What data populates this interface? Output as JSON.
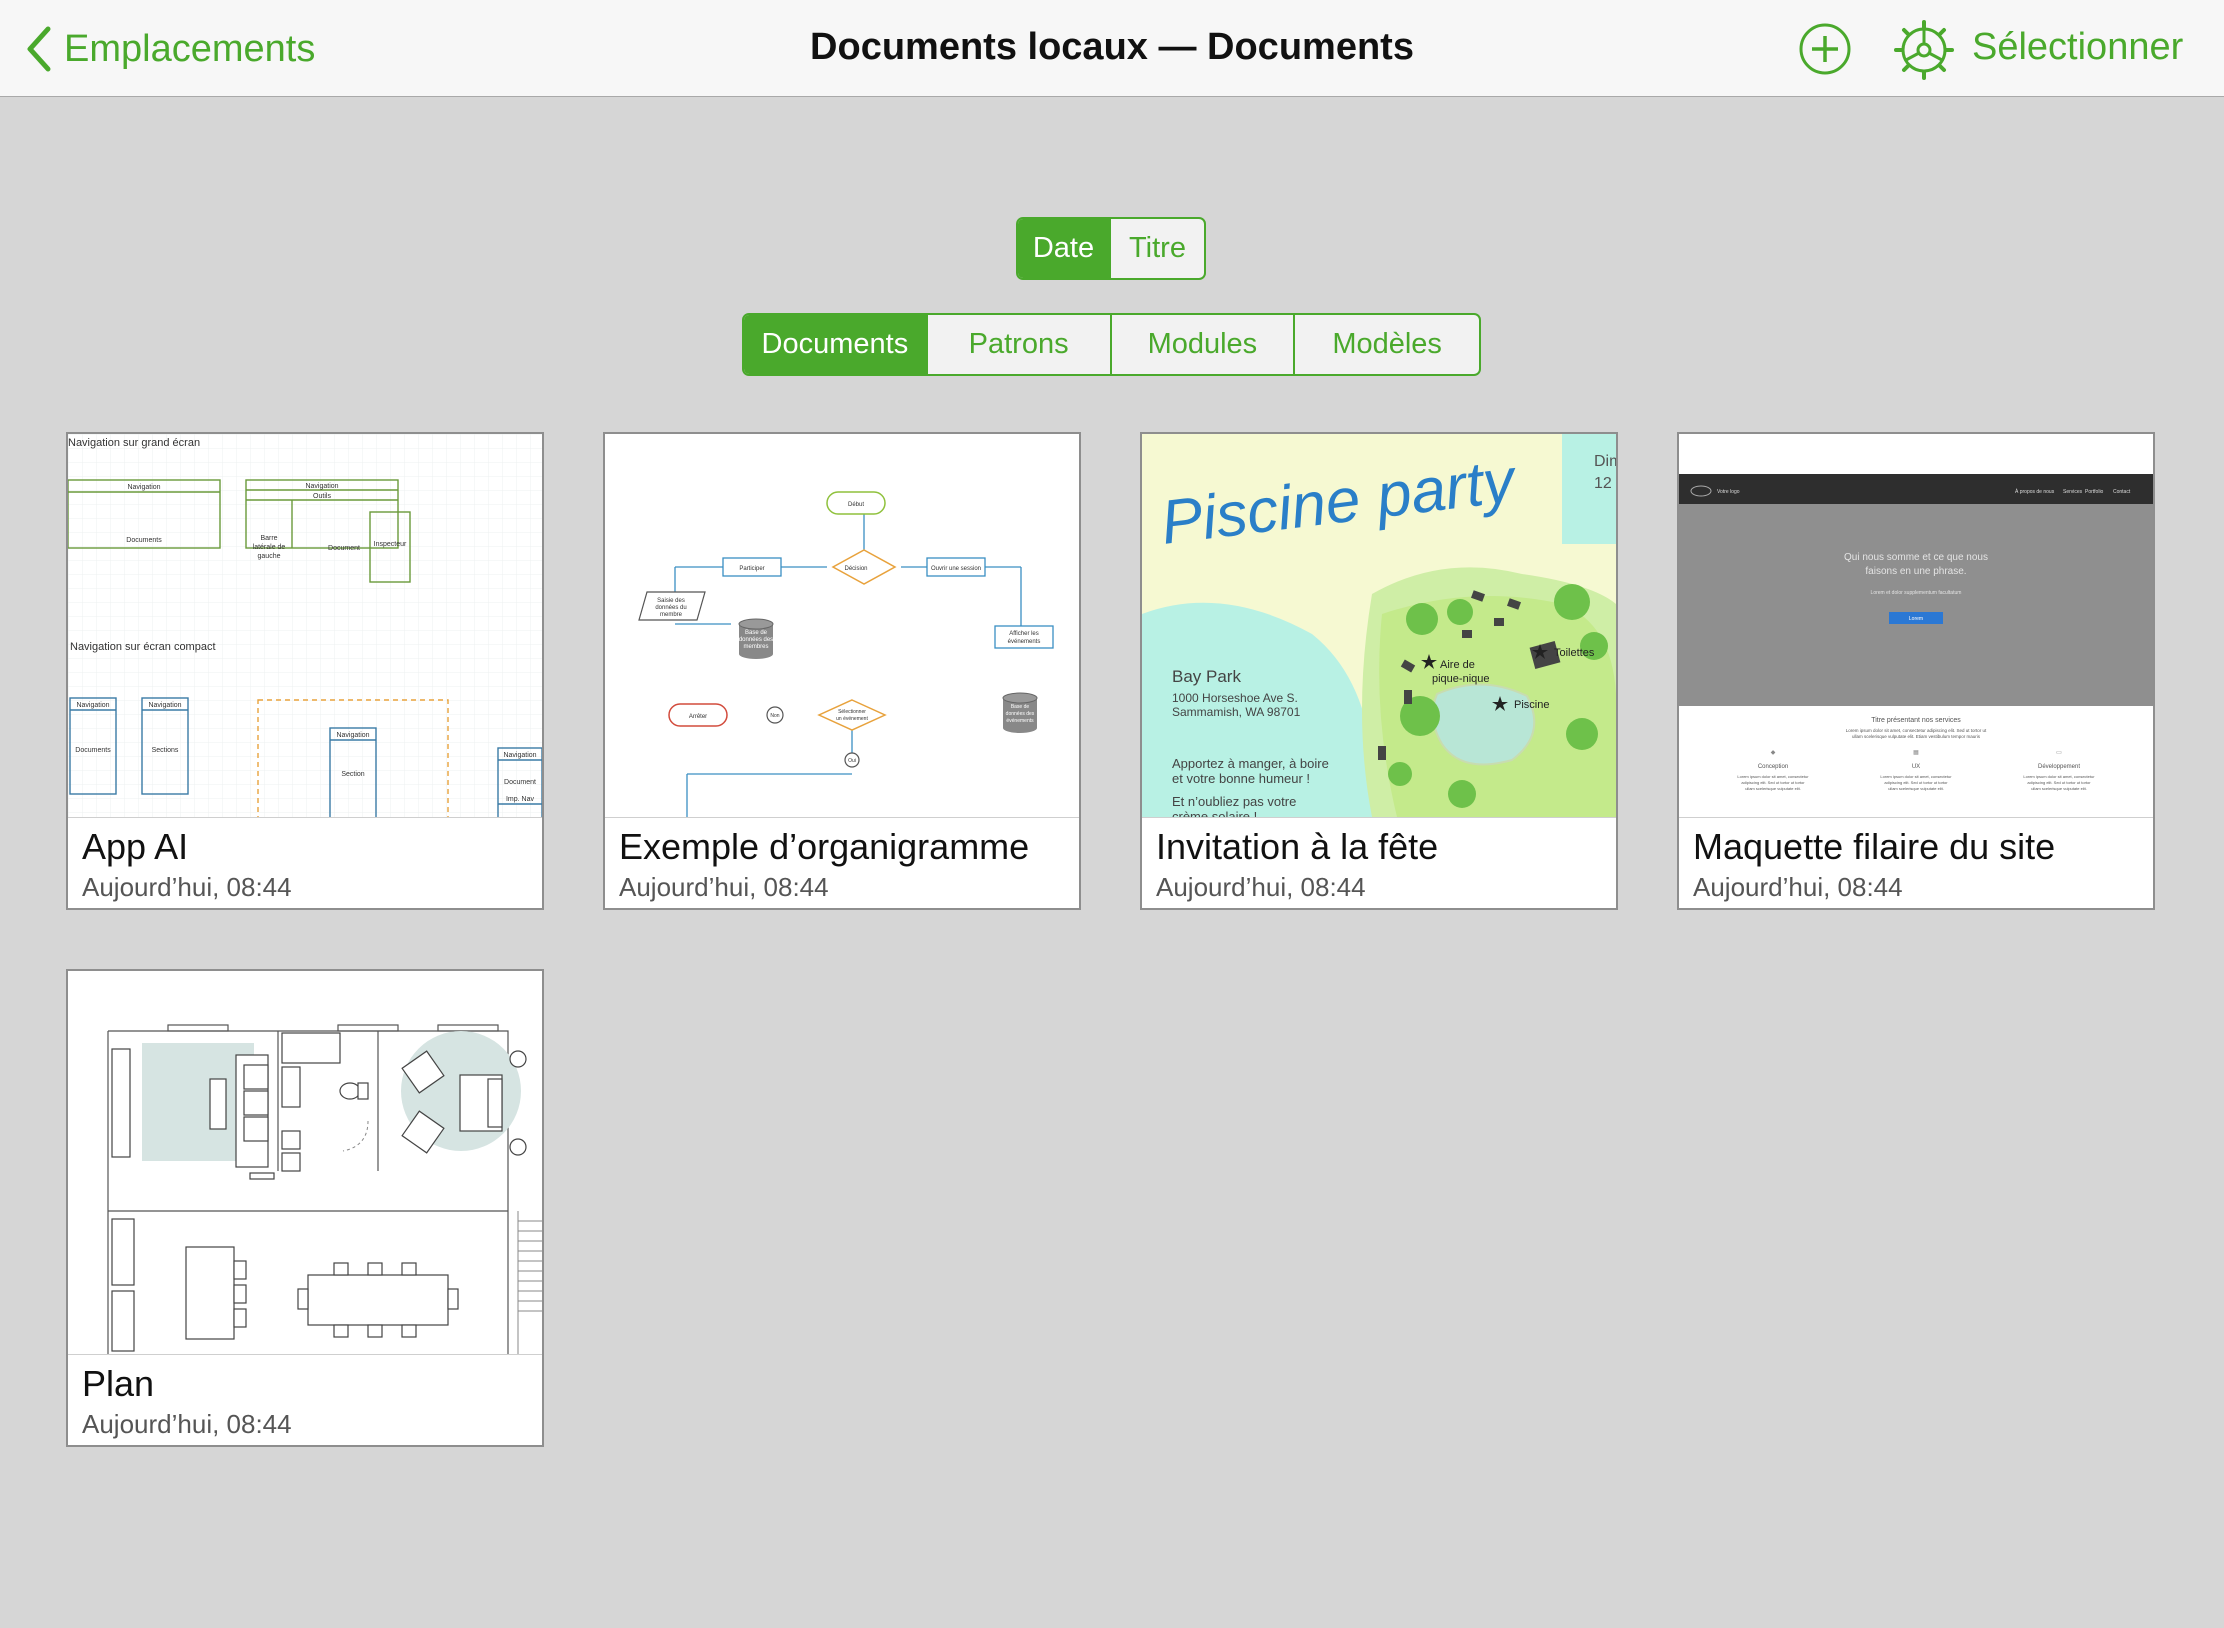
{
  "navbar": {
    "back_label": "Emplacements",
    "title": "Documents locaux — Documents",
    "add_icon": "plus-circle-icon",
    "settings_icon": "gear-icon",
    "select_label": "Sélectionner"
  },
  "sort_control": {
    "options": [
      "Date",
      "Titre"
    ],
    "selected": "Date"
  },
  "type_control": {
    "options": [
      "Documents",
      "Patrons",
      "Modules",
      "Modèles"
    ],
    "selected": "Documents"
  },
  "documents": [
    {
      "title": "App AI",
      "date": "Aujourd’hui, 08:44",
      "thumb": {
        "heading_large": "Navigation sur grand écran",
        "heading_compact": "Navigation sur écran compact",
        "nav": "Navigation",
        "outils": "Outils",
        "documents": "Documents",
        "barre": [
          "Barre",
          "latérale de",
          "gauche"
        ],
        "document": "Document",
        "inspecteur": "Inspecteur",
        "sections": "Sections",
        "section": "Section",
        "imp_nav": "Imp. Nav"
      }
    },
    {
      "title": "Exemple d’organigramme",
      "date": "Aujourd’hui, 08:44",
      "thumb": {
        "debut": "Début",
        "participer": "Participer",
        "decision": "Décision",
        "ouvrir": "Ouvrir une session",
        "saisie": [
          "Saisie des",
          "données du",
          "membre"
        ],
        "base": [
          "Base de",
          "données des",
          "membres"
        ],
        "afficher": [
          "Afficher les",
          "événements"
        ],
        "arreter": "Arrêter",
        "non": "Non",
        "selectionner": [
          "Sélectionner",
          "un événement"
        ],
        "base_evt": [
          "Base de",
          "données des",
          "événements"
        ],
        "oui": "Oui"
      }
    },
    {
      "title": "Invitation à la fête",
      "date": "Aujourd’hui, 08:44",
      "thumb": {
        "headline": "Piscine party",
        "day": "Dim",
        "daynum": "12",
        "place": "Bay Park",
        "address": [
          "1000 Horseshoe Ave S.",
          "Sammamish, WA 98701"
        ],
        "bring": [
          "Apportez à manger, à boire",
          "et votre bonne humeur !"
        ],
        "forget": [
          "Et n’oubliez pas votre",
          "crème solaire !"
        ],
        "picnic": [
          "Aire de",
          "pique-nique"
        ],
        "toilets": "Toilettes",
        "pool": "Piscine"
      }
    },
    {
      "title": "Maquette filaire du site",
      "date": "Aujourd’hui, 08:44",
      "thumb": {
        "logo": "Votre logo",
        "menu": [
          "À propos de nous",
          "Services",
          "Portfolio",
          "Contact"
        ],
        "hero": [
          "Qui nous somme et ce que nous",
          "faisons en une phrase."
        ],
        "hero_sub": "Lorem et dolor supplementum facultatum",
        "hero_button": "Lorem",
        "services_title": "Titre présentant nos services",
        "services_text": [
          "Lorem ipsum dolor sit amet, consectetur adipiscing elit. Sed ut tortor ut",
          "ullam scelerisque vulputate elit. Etiam vestibulum tempor mauris"
        ],
        "cols": [
          "Conception",
          "UX",
          "Développement"
        ],
        "col_text": [
          "Lorem ipsum dolor sit amet, consectetur",
          "adipiscing elit. Sed ut tortor ut tortor",
          "ullam scelerisque vulputate elit."
        ]
      }
    },
    {
      "title": "Plan",
      "date": "Aujourd’hui, 08:44",
      "thumb": {}
    }
  ]
}
